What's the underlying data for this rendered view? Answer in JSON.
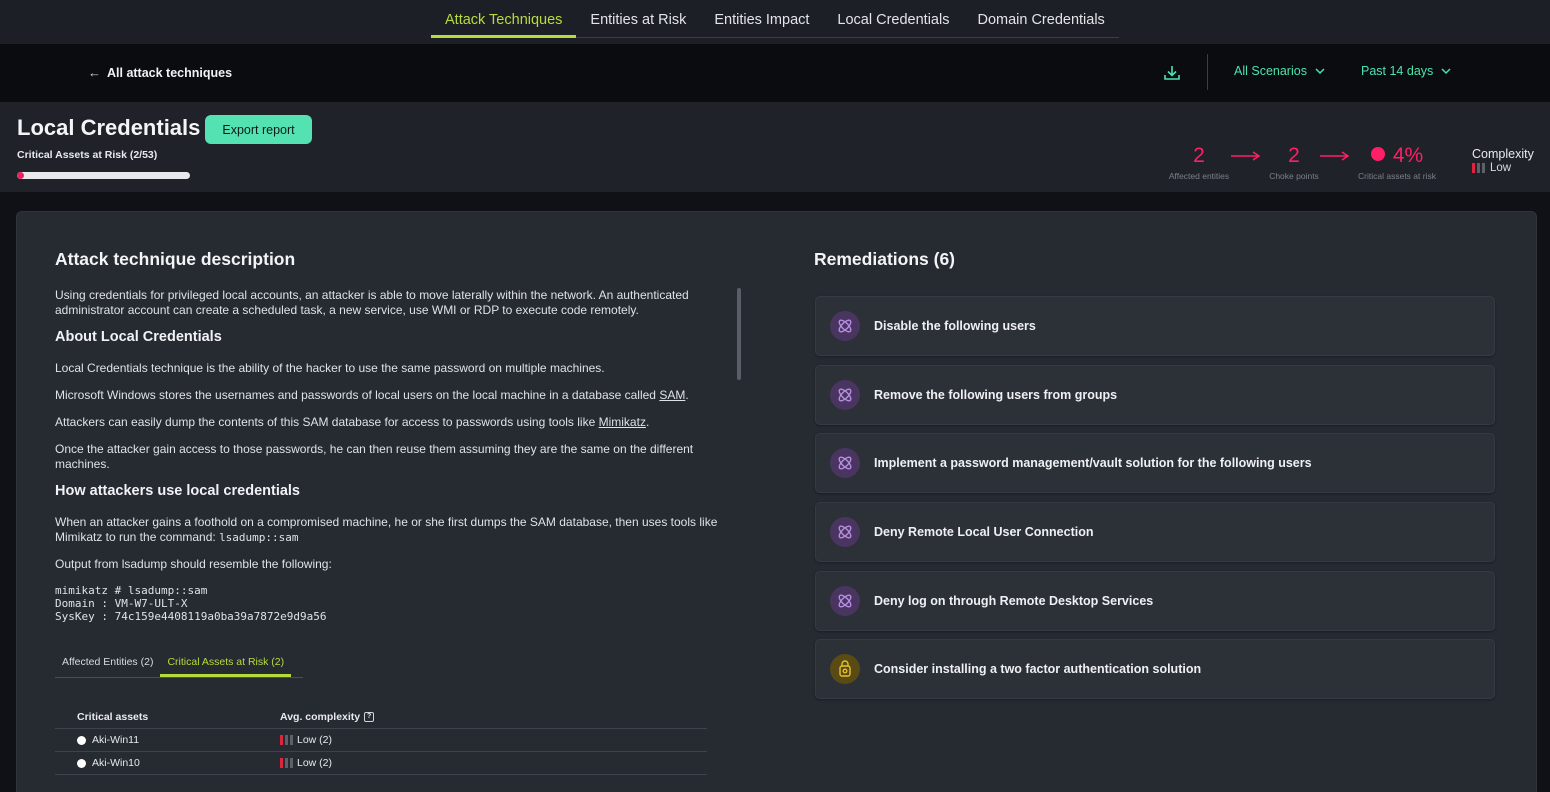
{
  "top_tabs": [
    {
      "label": "Attack Techniques",
      "active": true
    },
    {
      "label": "Entities at Risk",
      "active": false
    },
    {
      "label": "Entities Impact",
      "active": false
    },
    {
      "label": "Local Credentials",
      "active": false
    },
    {
      "label": "Domain Credentials",
      "active": false
    }
  ],
  "subbar": {
    "back_label": "All attack techniques",
    "scenarios_label": "All Scenarios",
    "period_label": "Past 14 days"
  },
  "header": {
    "title": "Local Credentials",
    "export_label": "Export report",
    "risk_label": "Critical Assets at Risk (2/53)",
    "risk_fraction": 0.04,
    "affected_num": "2",
    "affected_lbl": "Affected entities",
    "choke_num": "2",
    "choke_lbl": "Choke points",
    "critical_num": "4%",
    "critical_lbl": "Critical assets at risk",
    "complexity_title": "Complexity",
    "complexity_value": "Low"
  },
  "description": {
    "heading": "Attack technique description",
    "intro": "Using credentials for privileged local accounts, an attacker is able to move laterally within the network. An authenticated administrator account can create a scheduled task, a new service, use WMI or RDP to execute code remotely.",
    "about_heading": "About Local Credentials",
    "p1": "Local Credentials technique is the ability of the hacker to use the same password on multiple machines.",
    "p2_pre": "Microsoft Windows stores the usernames and passwords of local users on the local machine in a database called ",
    "p2_link": "SAM",
    "p2_post": ".",
    "p3_pre": "Attackers can easily dump the contents of this SAM database for access to passwords using tools like ",
    "p3_link": "Mimikatz",
    "p3_post": ".",
    "p4": "Once the attacker gain access to those passwords, he can then reuse them assuming they are the same on the different machines.",
    "how_heading": "How attackers use local credentials",
    "p5_pre": "When an attacker gains a foothold on a compromised machine, he or she first dumps the SAM database, then uses tools like Mimikatz to run the command: ",
    "p5_code": "lsadump::sam",
    "p6": "Output from lsadump should resemble the following:",
    "code_lines": [
      "mimikatz # lsadump::sam",
      "Domain : VM-W7-ULT-X",
      "SysKey : 74c159e4408119a0ba39a7872e9d9a56"
    ]
  },
  "subtabs": [
    {
      "label": "Affected Entities (2)",
      "active": false
    },
    {
      "label": "Critical Assets at Risk (2)",
      "active": true
    }
  ],
  "table": {
    "col1": "Critical assets",
    "col2": "Avg. complexity",
    "rows": [
      {
        "asset": "Aki-Win11",
        "complexity": "Low (2)"
      },
      {
        "asset": "Aki-Win10",
        "complexity": "Low (2)"
      }
    ]
  },
  "remediations": {
    "heading": "Remediations (6)",
    "items": [
      {
        "label": "Disable the following users",
        "icon": "remediation-icon"
      },
      {
        "label": "Remove the following users from groups",
        "icon": "remediation-icon"
      },
      {
        "label": "Implement a password management/vault solution for the following users",
        "icon": "remediation-icon"
      },
      {
        "label": "Deny Remote Local User Connection",
        "icon": "remediation-icon"
      },
      {
        "label": "Deny log on through Remote Desktop Services",
        "icon": "remediation-icon"
      },
      {
        "label": "Consider installing a two factor authentication solution",
        "icon": "two-factor-icon"
      }
    ]
  },
  "colors": {
    "accent_lime": "#b7dc3a",
    "accent_green": "#4be3ad",
    "risk_pink": "#ff1f66"
  }
}
